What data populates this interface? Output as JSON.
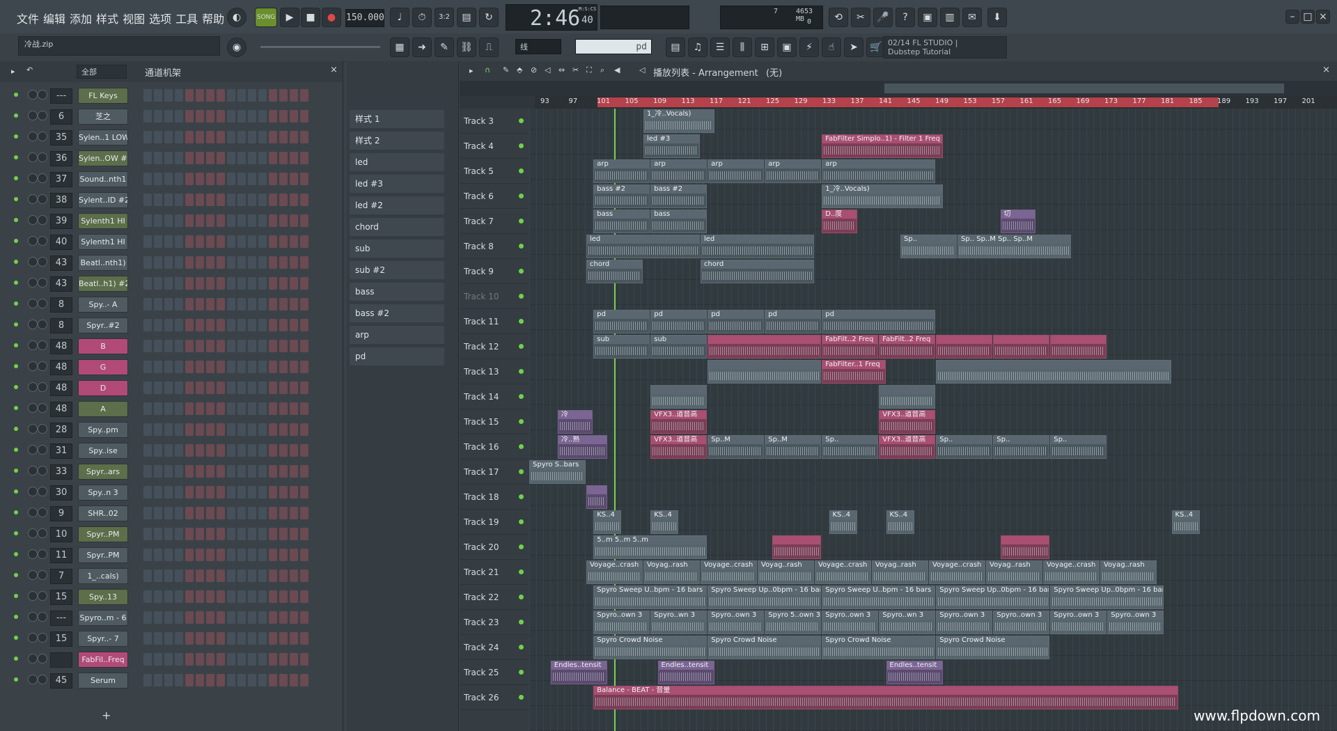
{
  "menu": [
    "文件",
    "编辑",
    "添加",
    "样式",
    "视图",
    "选项",
    "工具",
    "帮助"
  ],
  "transport": {
    "mode": "SONG",
    "tempo": "150.000",
    "time": "2:46",
    "time_sub": "40",
    "time_unit": "M:S:CS",
    "memory": "4653 MB",
    "cpu": "7",
    "poly": "0"
  },
  "toolbar2": {
    "project_name": "冷战.zip",
    "snap_label": "线",
    "pattern_label": "pd"
  },
  "hint": {
    "line1": "02/14 FL STUDIO |",
    "line2": "Dubstep Tutorial"
  },
  "rack": {
    "title": "通道机架",
    "filter": "全部",
    "channels": [
      {
        "mixer": "---",
        "name": "FL Keys"
      },
      {
        "mixer": "6",
        "name": "芝之"
      },
      {
        "mixer": "35",
        "name": "Sylen..1 LOW"
      },
      {
        "mixer": "36",
        "name": "Sylen..OW #2"
      },
      {
        "mixer": "37",
        "name": "Sound..nth1"
      },
      {
        "mixer": "38",
        "name": "Sylent..ID #2"
      },
      {
        "mixer": "39",
        "name": "Sylenth1 HI"
      },
      {
        "mixer": "40",
        "name": "Sylenth1 HI"
      },
      {
        "mixer": "43",
        "name": "Beatl..nth1)"
      },
      {
        "mixer": "43",
        "name": "Beatl..h1) #2"
      },
      {
        "mixer": "8",
        "name": "Spy..- A"
      },
      {
        "mixer": "8",
        "name": "Spyr..#2"
      },
      {
        "mixer": "48",
        "name": "B"
      },
      {
        "mixer": "48",
        "name": "G"
      },
      {
        "mixer": "48",
        "name": "D"
      },
      {
        "mixer": "48",
        "name": "A"
      },
      {
        "mixer": "28",
        "name": "Spy..pm"
      },
      {
        "mixer": "31",
        "name": "Spy..ise"
      },
      {
        "mixer": "33",
        "name": "Spyr..ars"
      },
      {
        "mixer": "30",
        "name": "Spy..n 3"
      },
      {
        "mixer": "9",
        "name": "SHR..02"
      },
      {
        "mixer": "10",
        "name": "Spyr..PM"
      },
      {
        "mixer": "11",
        "name": "Spyr..PM"
      },
      {
        "mixer": "7",
        "name": "1_..cals)"
      },
      {
        "mixer": "15",
        "name": "Spy..13"
      },
      {
        "mixer": "---",
        "name": "Spyro..m - 6"
      },
      {
        "mixer": "15",
        "name": "Spyr..- 7"
      },
      {
        "mixer": "",
        "name": "FabFil..Freq"
      },
      {
        "mixer": "45",
        "name": "Serum"
      }
    ],
    "add": "+"
  },
  "patterns": [
    "样式 1",
    "样式 2",
    "led",
    "led #3",
    "led #2",
    "chord",
    "sub",
    "sub #2",
    "bass",
    "bass #2",
    "arp",
    "pd"
  ],
  "playlist": {
    "title": "播放列表 - Arrangement",
    "breadcrumb": "(无)",
    "ruler": [
      "93",
      "97",
      "101",
      "105",
      "109",
      "113",
      "117",
      "121",
      "125",
      "129",
      "133",
      "137",
      "141",
      "145",
      "149",
      "153",
      "157",
      "161",
      "165",
      "169",
      "173",
      "177",
      "181",
      "185",
      "189",
      "193",
      "197",
      "201"
    ],
    "tracks": [
      "Track 3",
      "Track 4",
      "Track 5",
      "Track 6",
      "Track 7",
      "Track 8",
      "Track 9",
      "Track 10",
      "Track 11",
      "Track 12",
      "Track 13",
      "Track 14",
      "Track 15",
      "Track 16",
      "Track 17",
      "Track 18",
      "Track 19",
      "Track 20",
      "Track 21",
      "Track 22",
      "Track 23",
      "Track 24",
      "Track 25",
      "Track 26"
    ],
    "clips": [
      {
        "t": 0,
        "s": 16,
        "w": 10,
        "label": "1_冷..Vocals)",
        "k": "audio"
      },
      {
        "t": 1,
        "s": 16,
        "w": 8,
        "label": "led #3",
        "k": ""
      },
      {
        "t": 1,
        "s": 41,
        "w": 17,
        "label": "FabFilter Simplo..1) - Filter 1 Freq",
        "k": "pink"
      },
      {
        "t": 2,
        "s": 9,
        "w": 8,
        "label": "arp",
        "k": ""
      },
      {
        "t": 2,
        "s": 17,
        "w": 8,
        "label": "arp",
        "k": ""
      },
      {
        "t": 2,
        "s": 25,
        "w": 8,
        "label": "arp",
        "k": ""
      },
      {
        "t": 2,
        "s": 33,
        "w": 8,
        "label": "arp",
        "k": ""
      },
      {
        "t": 2,
        "s": 41,
        "w": 16,
        "label": "arp",
        "k": ""
      },
      {
        "t": 3,
        "s": 9,
        "w": 8,
        "label": "bass #2",
        "k": ""
      },
      {
        "t": 3,
        "s": 17,
        "w": 8,
        "label": "bass #2",
        "k": ""
      },
      {
        "t": 3,
        "s": 41,
        "w": 17,
        "label": "1_冷..Vocals)",
        "k": "audio"
      },
      {
        "t": 4,
        "s": 9,
        "w": 8,
        "label": "bass",
        "k": ""
      },
      {
        "t": 4,
        "s": 17,
        "w": 8,
        "label": "bass",
        "k": ""
      },
      {
        "t": 4,
        "s": 41,
        "w": 5,
        "label": "D..度",
        "k": "pink"
      },
      {
        "t": 4,
        "s": 66,
        "w": 5,
        "label": "切",
        "k": "purple"
      },
      {
        "t": 5,
        "s": 8,
        "w": 16,
        "label": "led",
        "k": ""
      },
      {
        "t": 5,
        "s": 24,
        "w": 16,
        "label": "led",
        "k": ""
      },
      {
        "t": 5,
        "s": 52,
        "w": 8,
        "label": "Sp..",
        "k": "audio"
      },
      {
        "t": 5,
        "s": 60,
        "w": 16,
        "label": "Sp.. Sp..M Sp.. Sp..M",
        "k": "audio"
      },
      {
        "t": 6,
        "s": 8,
        "w": 8,
        "label": "chord",
        "k": ""
      },
      {
        "t": 6,
        "s": 24,
        "w": 16,
        "label": "chord",
        "k": ""
      },
      {
        "t": 8,
        "s": 9,
        "w": 8,
        "label": "pd",
        "k": ""
      },
      {
        "t": 8,
        "s": 17,
        "w": 8,
        "label": "pd",
        "k": ""
      },
      {
        "t": 8,
        "s": 25,
        "w": 8,
        "label": "pd",
        "k": ""
      },
      {
        "t": 8,
        "s": 33,
        "w": 8,
        "label": "pd",
        "k": ""
      },
      {
        "t": 8,
        "s": 41,
        "w": 16,
        "label": "pd",
        "k": ""
      },
      {
        "t": 9,
        "s": 9,
        "w": 8,
        "label": "sub",
        "k": ""
      },
      {
        "t": 9,
        "s": 17,
        "w": 8,
        "label": "sub",
        "k": ""
      },
      {
        "t": 9,
        "s": 25,
        "w": 16,
        "label": "",
        "k": "pink"
      },
      {
        "t": 9,
        "s": 41,
        "w": 8,
        "label": "FabFilt..2 Freq",
        "k": "pink"
      },
      {
        "t": 9,
        "s": 49,
        "w": 8,
        "label": "FabFilt..2 Freq",
        "k": "pink"
      },
      {
        "t": 9,
        "s": 57,
        "w": 8,
        "label": "",
        "k": "pink"
      },
      {
        "t": 9,
        "s": 65,
        "w": 8,
        "label": "",
        "k": "pink"
      },
      {
        "t": 9,
        "s": 73,
        "w": 8,
        "label": "",
        "k": "pink"
      },
      {
        "t": 10,
        "s": 25,
        "w": 16,
        "label": "",
        "k": "audio"
      },
      {
        "t": 10,
        "s": 41,
        "w": 9,
        "label": "FabFilter..1 Freq",
        "k": "pink"
      },
      {
        "t": 10,
        "s": 57,
        "w": 33,
        "label": "",
        "k": "audio"
      },
      {
        "t": 11,
        "s": 17,
        "w": 8,
        "label": "",
        "k": "audio"
      },
      {
        "t": 11,
        "s": 49,
        "w": 8,
        "label": "",
        "k": "audio"
      },
      {
        "t": 12,
        "s": 4,
        "w": 5,
        "label": "冷",
        "k": "purple"
      },
      {
        "t": 12,
        "s": 17,
        "w": 8,
        "label": "VFX3..道音高",
        "k": "pink"
      },
      {
        "t": 12,
        "s": 49,
        "w": 8,
        "label": "VFX3..道音高",
        "k": "pink"
      },
      {
        "t": 13,
        "s": 4,
        "w": 7,
        "label": "冷..熟",
        "k": "purple"
      },
      {
        "t": 13,
        "s": 17,
        "w": 8,
        "label": "VFX3..道音高",
        "k": "pink"
      },
      {
        "t": 13,
        "s": 25,
        "w": 8,
        "label": "Sp..M",
        "k": ""
      },
      {
        "t": 13,
        "s": 33,
        "w": 8,
        "label": "Sp..M",
        "k": ""
      },
      {
        "t": 13,
        "s": 41,
        "w": 8,
        "label": "Sp..",
        "k": ""
      },
      {
        "t": 13,
        "s": 49,
        "w": 8,
        "label": "VFX3..道音高",
        "k": "pink"
      },
      {
        "t": 13,
        "s": 57,
        "w": 8,
        "label": "Sp..",
        "k": ""
      },
      {
        "t": 13,
        "s": 65,
        "w": 8,
        "label": "Sp..",
        "k": ""
      },
      {
        "t": 13,
        "s": 73,
        "w": 8,
        "label": "Sp..",
        "k": ""
      },
      {
        "t": 14,
        "s": 0,
        "w": 8,
        "label": "Spyro S..bars",
        "k": "audio"
      },
      {
        "t": 15,
        "s": 8,
        "w": 3,
        "label": "",
        "k": "purple"
      },
      {
        "t": 16,
        "s": 9,
        "w": 4,
        "label": "KS..4",
        "k": "audio"
      },
      {
        "t": 16,
        "s": 17,
        "w": 4,
        "label": "KS..4",
        "k": "audio"
      },
      {
        "t": 16,
        "s": 42,
        "w": 4,
        "label": "KS..4",
        "k": "audio"
      },
      {
        "t": 16,
        "s": 50,
        "w": 4,
        "label": "KS..4",
        "k": "audio"
      },
      {
        "t": 16,
        "s": 90,
        "w": 4,
        "label": "KS..4",
        "k": "audio"
      },
      {
        "t": 17,
        "s": 9,
        "w": 16,
        "label": "5..m  5..m  5..m",
        "k": "audio"
      },
      {
        "t": 17,
        "s": 34,
        "w": 7,
        "label": "",
        "k": "pink"
      },
      {
        "t": 17,
        "s": 66,
        "w": 7,
        "label": "",
        "k": "pink"
      },
      {
        "t": 18,
        "s": 8,
        "w": 8,
        "label": "Voyage..crash",
        "k": "audio"
      },
      {
        "t": 18,
        "s": 16,
        "w": 8,
        "label": "Voyag..rash",
        "k": "audio"
      },
      {
        "t": 18,
        "s": 24,
        "w": 8,
        "label": "Voyage..crash",
        "k": "audio"
      },
      {
        "t": 18,
        "s": 32,
        "w": 8,
        "label": "Voyag..rash",
        "k": "audio"
      },
      {
        "t": 18,
        "s": 40,
        "w": 8,
        "label": "Voyage..crash",
        "k": "audio"
      },
      {
        "t": 18,
        "s": 48,
        "w": 8,
        "label": "Voyag..rash",
        "k": "audio"
      },
      {
        "t": 18,
        "s": 56,
        "w": 8,
        "label": "Voyage..crash",
        "k": "audio"
      },
      {
        "t": 18,
        "s": 64,
        "w": 8,
        "label": "Voyag..rash",
        "k": "audio"
      },
      {
        "t": 18,
        "s": 72,
        "w": 8,
        "label": "Voyage..crash",
        "k": "audio"
      },
      {
        "t": 18,
        "s": 80,
        "w": 8,
        "label": "Voyag..rash",
        "k": "audio"
      },
      {
        "t": 19,
        "s": 9,
        "w": 16,
        "label": "Spyro Sweep U..bpm - 16 bars",
        "k": "audio"
      },
      {
        "t": 19,
        "s": 25,
        "w": 16,
        "label": "Spyro Sweep Up..0bpm - 16 bars",
        "k": "audio"
      },
      {
        "t": 19,
        "s": 41,
        "w": 16,
        "label": "Spyro Sweep U..bpm - 16 bars",
        "k": "audio"
      },
      {
        "t": 19,
        "s": 57,
        "w": 16,
        "label": "Spyro Sweep Up..0bpm - 16 bars",
        "k": "audio"
      },
      {
        "t": 19,
        "s": 73,
        "w": 16,
        "label": "Spyro Sweep Up..0bpm - 16 bars",
        "k": "audio"
      },
      {
        "t": 20,
        "s": 9,
        "w": 8,
        "label": "Spyro..own 3",
        "k": "audio"
      },
      {
        "t": 20,
        "s": 17,
        "w": 8,
        "label": "Spyro..wn 3",
        "k": "audio"
      },
      {
        "t": 20,
        "s": 25,
        "w": 8,
        "label": "Spyro..own 3",
        "k": "audio"
      },
      {
        "t": 20,
        "s": 33,
        "w": 8,
        "label": "Spyro 5..own 3",
        "k": "audio"
      },
      {
        "t": 20,
        "s": 41,
        "w": 8,
        "label": "Spyro..own 3",
        "k": "audio"
      },
      {
        "t": 20,
        "s": 49,
        "w": 8,
        "label": "Spyro..wn 3",
        "k": "audio"
      },
      {
        "t": 20,
        "s": 57,
        "w": 8,
        "label": "Spyro..own 3",
        "k": "audio"
      },
      {
        "t": 20,
        "s": 65,
        "w": 8,
        "label": "Spyro..own 3",
        "k": "audio"
      },
      {
        "t": 20,
        "s": 73,
        "w": 8,
        "label": "Spyro..own 3",
        "k": "audio"
      },
      {
        "t": 20,
        "s": 81,
        "w": 8,
        "label": "Spyro..own 3",
        "k": "audio"
      },
      {
        "t": 21,
        "s": 9,
        "w": 16,
        "label": "Spyro Crowd Noise",
        "k": "audio"
      },
      {
        "t": 21,
        "s": 25,
        "w": 16,
        "label": "Spyro Crowd Noise",
        "k": "audio"
      },
      {
        "t": 21,
        "s": 41,
        "w": 16,
        "label": "Spyro Crowd Noise",
        "k": "audio"
      },
      {
        "t": 21,
        "s": 57,
        "w": 16,
        "label": "Spyro Crowd Noise",
        "k": "audio"
      },
      {
        "t": 22,
        "s": 3,
        "w": 8,
        "label": "Endles..tensit",
        "k": "purple"
      },
      {
        "t": 22,
        "s": 18,
        "w": 8,
        "label": "Endles..tensit",
        "k": "purple"
      },
      {
        "t": 22,
        "s": 50,
        "w": 8,
        "label": "Endles..tensit",
        "k": "purple"
      },
      {
        "t": 23,
        "s": 9,
        "w": 82,
        "label": "Balance - BEAT - 音量",
        "k": "pink"
      }
    ]
  },
  "watermark": "www.flpdown.com"
}
